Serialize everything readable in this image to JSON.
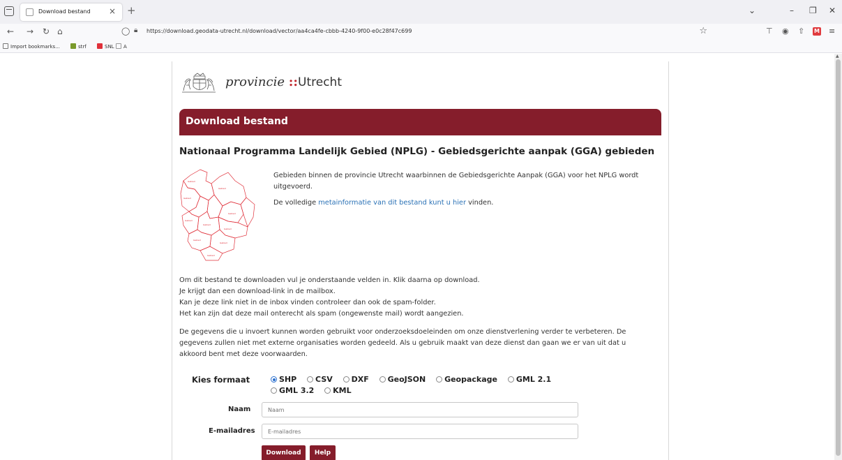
{
  "browser": {
    "tab_title": "Download bestand",
    "url": "https://download.geodata-utrecht.nl/download/vector/aa4ca4fe-cbbb-4240-9f00-e0c28f47c699",
    "bookmarks": [
      {
        "label": "Import bookmarks...",
        "icon": "import-icon"
      },
      {
        "label": "strf",
        "icon": "strf-icon"
      },
      {
        "label": "SNL",
        "icon": "snl-icon"
      },
      {
        "label": "A",
        "icon": "page-icon"
      }
    ]
  },
  "logo": {
    "text_a": "provincie",
    "dots": "::",
    "text_b": "Utrecht"
  },
  "banner_title": "Download bestand",
  "dataset_title": "Nationaal Programma Landelijk Gebied (NPLG) - Gebiedsgerichte aanpak (GGA) gebieden",
  "description": {
    "text": "Gebieden binnen de provincie Utrecht waarbinnen de Gebiedsgerichte Aanpak (GGA) voor het NPLG wordt uitgevoerd.",
    "meta_prefix": "De volledige",
    "meta_link": "metainformatie van dit bestand kunt u hier",
    "meta_suffix": "vinden."
  },
  "instructions": [
    "Om dit bestand te downloaden vul je onderstaande velden in. Klik daarna op download.",
    "Je krijgt dan een download-link in de mailbox.",
    "Kan je deze link niet in de inbox vinden controleer dan ook de spam-folder.",
    "Het kan zijn dat deze mail onterecht als spam (ongewenste mail) wordt aangezien."
  ],
  "privacy": "De gegevens die u invoert kunnen worden gebruikt voor onderzoeksdoeleinden om onze dienstverlening verder te verbeteren. De gegevens zullen niet met externe organisaties worden gedeeld. Als u gebruik maakt van deze dienst dan gaan we er van uit dat u akkoord bent met deze voorwaarden.",
  "form": {
    "format_label": "Kies formaat",
    "formats": [
      "SHP",
      "CSV",
      "DXF",
      "GeoJSON",
      "Geopackage",
      "GML 2.1",
      "GML 3.2",
      "KML"
    ],
    "selected_format": "SHP",
    "name_label": "Naam",
    "name_placeholder": "Naam",
    "email_label": "E-mailadres",
    "email_placeholder": "E-mailadres",
    "download_label": "Download",
    "help_label": "Help"
  },
  "colors": {
    "brand": "#851d2b",
    "link": "#2b72b6",
    "map_outline": "#e0303a"
  }
}
